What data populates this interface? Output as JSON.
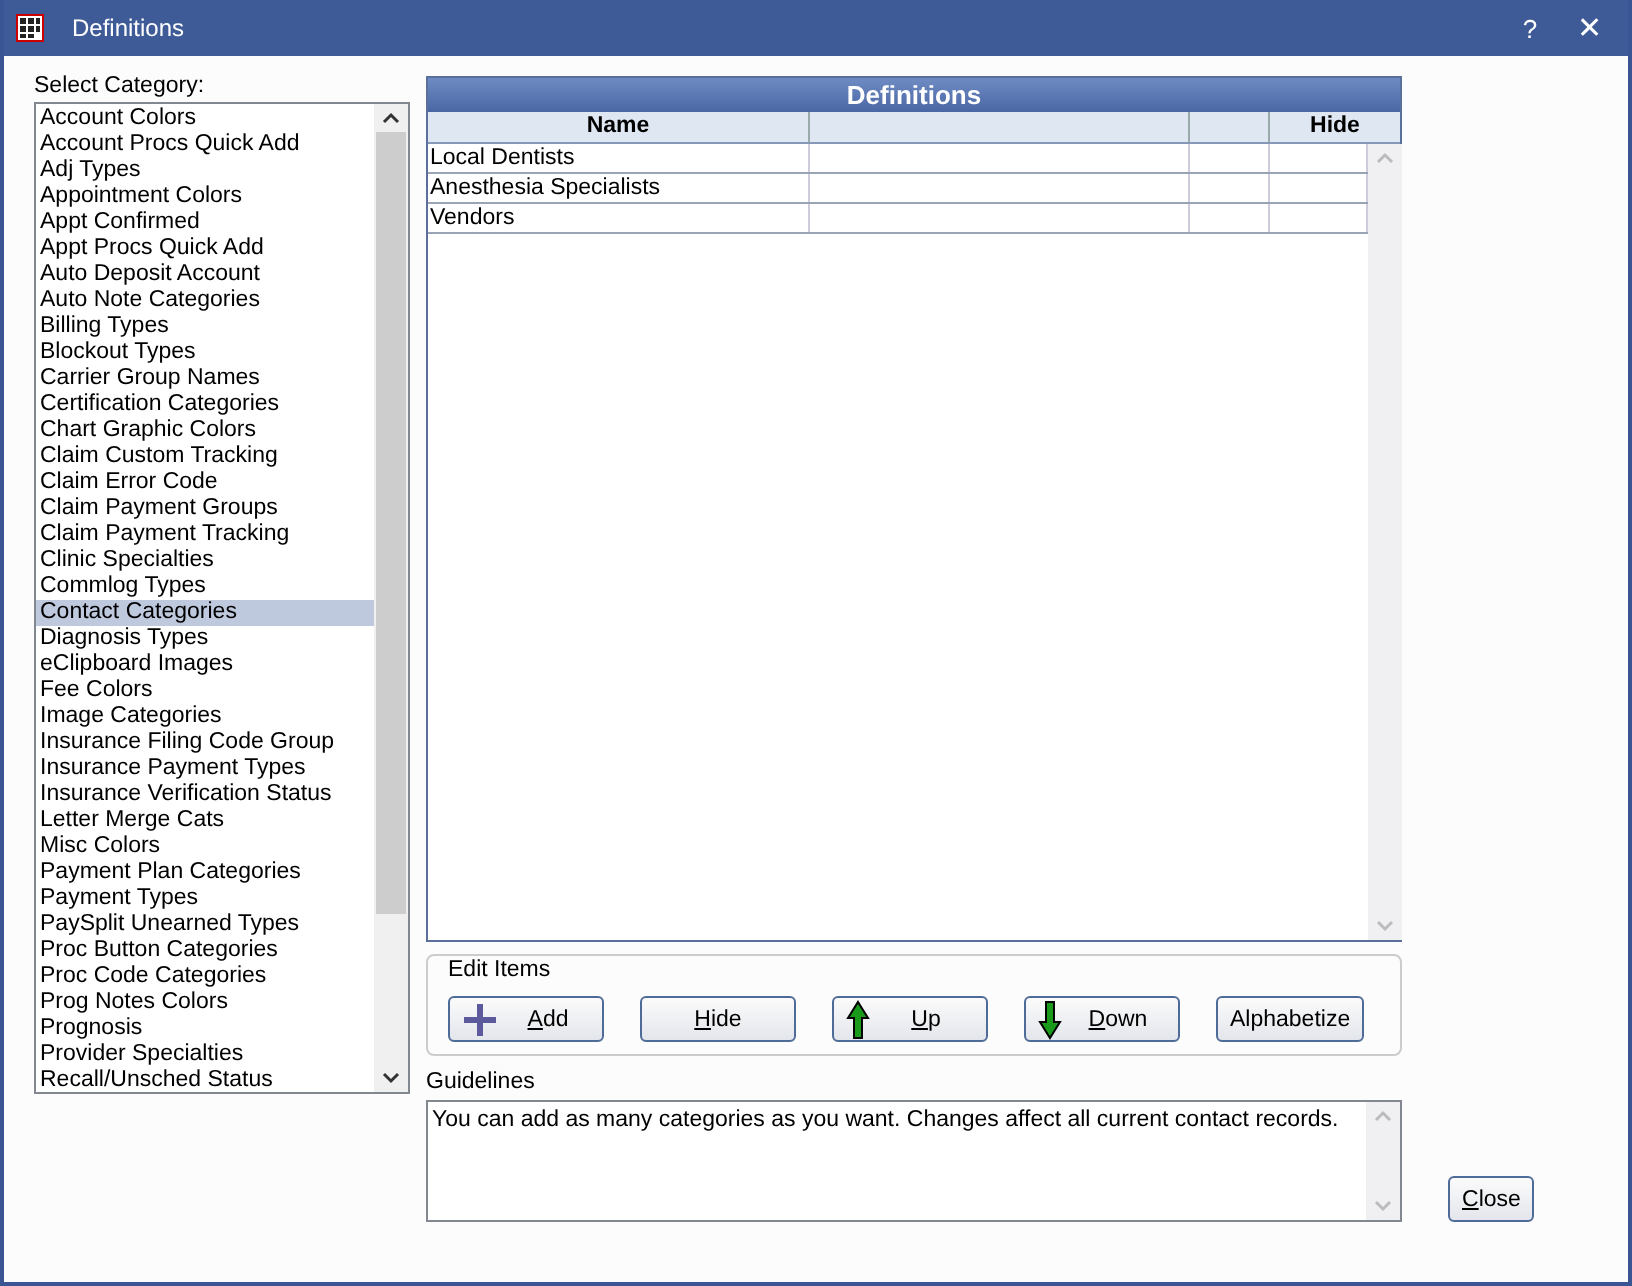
{
  "window": {
    "title": "Definitions",
    "help": "?",
    "close": "✕"
  },
  "category_list": {
    "label": "Select Category:",
    "items": [
      {
        "label": "Account Colors",
        "selected": false
      },
      {
        "label": "Account Procs Quick Add",
        "selected": false
      },
      {
        "label": "Adj Types",
        "selected": false
      },
      {
        "label": "Appointment Colors",
        "selected": false
      },
      {
        "label": "Appt Confirmed",
        "selected": false
      },
      {
        "label": "Appt Procs Quick Add",
        "selected": false
      },
      {
        "label": "Auto Deposit Account",
        "selected": false
      },
      {
        "label": "Auto Note Categories",
        "selected": false
      },
      {
        "label": "Billing Types",
        "selected": false
      },
      {
        "label": "Blockout Types",
        "selected": false
      },
      {
        "label": "Carrier Group Names",
        "selected": false
      },
      {
        "label": "Certification Categories",
        "selected": false
      },
      {
        "label": "Chart Graphic Colors",
        "selected": false
      },
      {
        "label": "Claim Custom Tracking",
        "selected": false
      },
      {
        "label": "Claim Error Code",
        "selected": false
      },
      {
        "label": "Claim Payment Groups",
        "selected": false
      },
      {
        "label": "Claim Payment Tracking",
        "selected": false
      },
      {
        "label": "Clinic Specialties",
        "selected": false
      },
      {
        "label": "Commlog Types",
        "selected": false
      },
      {
        "label": "Contact Categories",
        "selected": true
      },
      {
        "label": "Diagnosis Types",
        "selected": false
      },
      {
        "label": "eClipboard Images",
        "selected": false
      },
      {
        "label": "Fee Colors",
        "selected": false
      },
      {
        "label": "Image Categories",
        "selected": false
      },
      {
        "label": "Insurance Filing Code Group",
        "selected": false
      },
      {
        "label": "Insurance Payment Types",
        "selected": false
      },
      {
        "label": "Insurance Verification Status",
        "selected": false
      },
      {
        "label": "Letter Merge Cats",
        "selected": false
      },
      {
        "label": "Misc Colors",
        "selected": false
      },
      {
        "label": "Payment Plan Categories",
        "selected": false
      },
      {
        "label": "Payment Types",
        "selected": false
      },
      {
        "label": "PaySplit Unearned Types",
        "selected": false
      },
      {
        "label": "Proc Button Categories",
        "selected": false
      },
      {
        "label": "Proc Code Categories",
        "selected": false
      },
      {
        "label": "Prog Notes Colors",
        "selected": false
      },
      {
        "label": "Prognosis",
        "selected": false
      },
      {
        "label": "Provider Specialties",
        "selected": false
      },
      {
        "label": "Recall/Unsched Status",
        "selected": false
      }
    ]
  },
  "definitions_grid": {
    "title": "Definitions",
    "columns": [
      {
        "heading": "Name"
      },
      {},
      {},
      {
        "heading": "Hide"
      }
    ],
    "rows": [
      {
        "name": "Local Dentists",
        "hidden": false
      },
      {
        "name": "Anesthesia Specialists",
        "hidden": false
      },
      {
        "name": "Vendors",
        "hidden": false
      }
    ]
  },
  "edit_items": {
    "label": "Edit Items",
    "buttons": [
      {
        "label": "Add",
        "kind": "add",
        "underline_first": true
      },
      {
        "label": "Hide",
        "kind": "plain",
        "underline_first": true
      },
      {
        "label": "Up",
        "kind": "up",
        "underline_first": true
      },
      {
        "label": "Down",
        "kind": "down",
        "underline_first": true
      },
      {
        "label": "Alphabetize",
        "kind": "plain",
        "underline_first": false
      }
    ]
  },
  "guidelines": {
    "label": "Guidelines",
    "text": "You can add as many categories as you want.  Changes affect all current contact records."
  },
  "close_button": {
    "label": "Close",
    "underline_first": true
  }
}
